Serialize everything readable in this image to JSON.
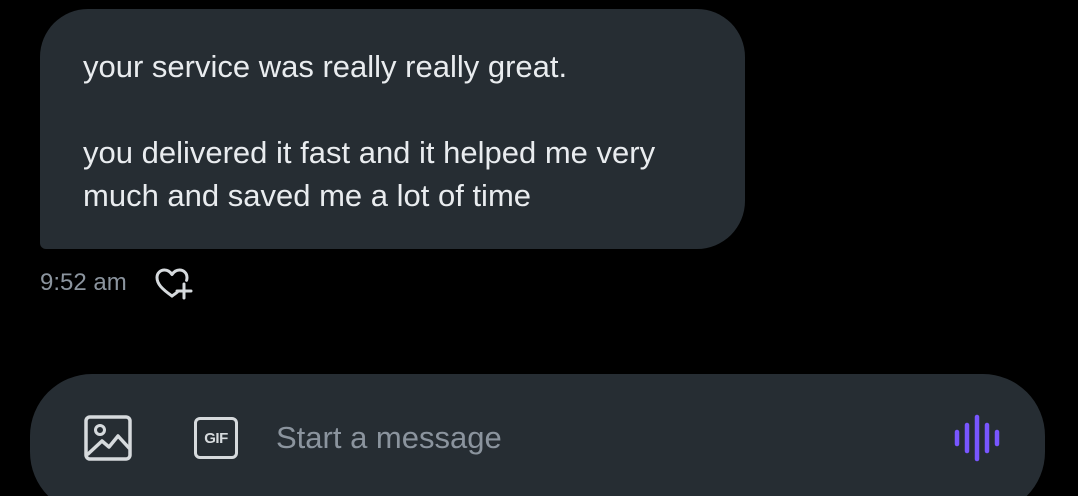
{
  "message": {
    "paragraphs": [
      "your service was really really great.",
      "you delivered it fast and it helped me very\nmuch and saved me a lot of time"
    ],
    "timestamp": "9:52 am",
    "bubble_color": "#262d33",
    "text_color": "#e9ecef"
  },
  "reaction": {
    "icon": "heart-plus-icon"
  },
  "composer": {
    "placeholder": "Start a message",
    "value": "",
    "image_icon": "image-icon",
    "gif_label": "GIF",
    "voice_icon": "voice-waveform-icon",
    "accent_color": "#7856ff"
  }
}
